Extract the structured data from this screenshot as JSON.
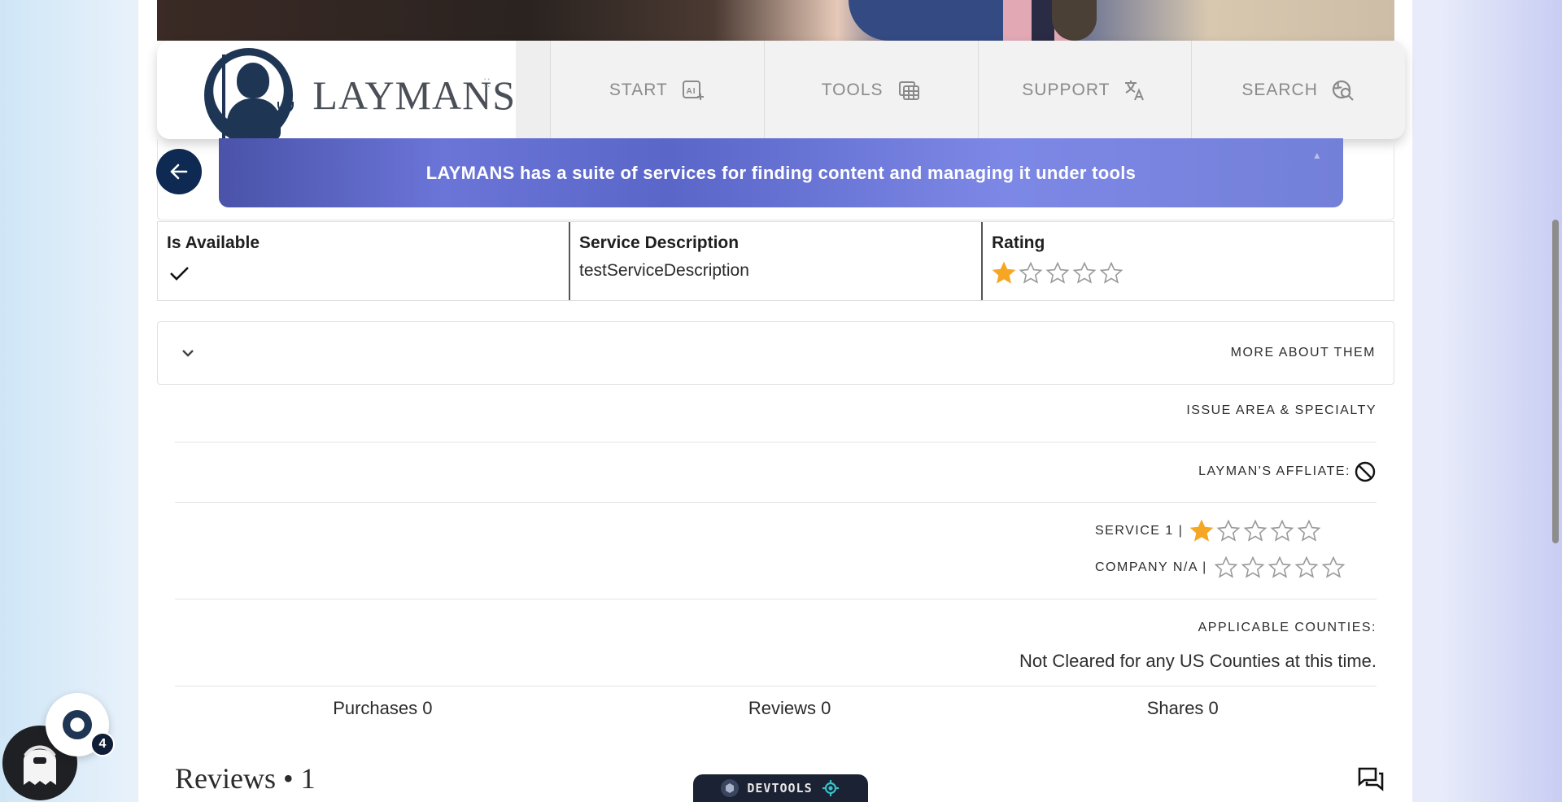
{
  "nav": {
    "brand": "LAYMANS",
    "items": [
      {
        "label": "START",
        "icon": "ai-sparkle-icon"
      },
      {
        "label": "TOOLS",
        "icon": "table-icon"
      },
      {
        "label": "SUPPORT",
        "icon": "translate-icon"
      },
      {
        "label": "SEARCH",
        "icon": "search-globe-icon"
      }
    ]
  },
  "banner": {
    "text": "LAYMANS has a suite of services for finding content and managing it under tools"
  },
  "info": {
    "available_label": "Is Available",
    "description_label": "Service Description",
    "description_value": "testServiceDescription",
    "rating_label": "Rating",
    "rating_value": 1,
    "rating_max": 5
  },
  "accordion": {
    "label": "MORE ABOUT THEM"
  },
  "details": {
    "issue_area": "ISSUE AREA & SPECIALTY",
    "affiliate": "LAYMAN'S AFFLIATE:",
    "service_rating_label": "SERVICE 1 |",
    "service_rating_value": 1,
    "company_rating_label": "COMPANY N/A |",
    "company_rating_value": 0,
    "counties_label": "APPLICABLE COUNTIES:",
    "counties_value": "Not Cleared for any US Counties at this time."
  },
  "stats": {
    "purchases": "Purchases 0",
    "reviews": "Reviews 0",
    "shares": "Shares 0"
  },
  "reviews": {
    "title": "Reviews • 1"
  },
  "devtools": {
    "label": "DEVTOOLS"
  },
  "notifications": {
    "badge_count": "4"
  },
  "colors": {
    "navy": "#0e2a52",
    "star_fill": "#f5a623",
    "banner_start": "#4a53a8",
    "banner_end": "#7380d8"
  }
}
